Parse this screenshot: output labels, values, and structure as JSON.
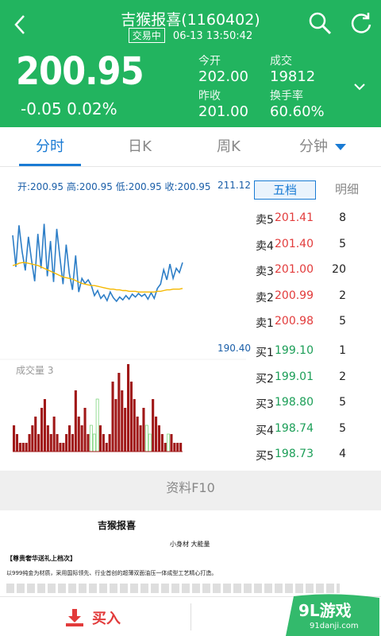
{
  "header": {
    "title": "吉猴报喜(1160402)",
    "status_badge": "交易中",
    "timestamp": "06-13 13:50:42",
    "price": "200.95",
    "change": "-0.05 0.02%",
    "stats": [
      {
        "label": "今开",
        "value": "202.00"
      },
      {
        "label": "成交",
        "value": "19812"
      },
      {
        "label": "昨收",
        "value": "201.00"
      },
      {
        "label": "换手率",
        "value": "60.60%"
      }
    ]
  },
  "tabs": [
    {
      "label": "分时",
      "active": true
    },
    {
      "label": "日K",
      "active": false
    },
    {
      "label": "周K",
      "active": false
    },
    {
      "label": "分钟",
      "active": false
    }
  ],
  "chart": {
    "stats_line": "开:200.95 高:200.95 低:200.95 收:200.95",
    "y_max": "211.12",
    "y_min": "190.40",
    "volume_label": "成交量 3"
  },
  "chart_data": {
    "type": "line",
    "series": [
      {
        "values": [
          205.8,
          201.4,
          207.2,
          203.5,
          200.9,
          205.6,
          202.3,
          199.4,
          206.0,
          201.2,
          207.4,
          200.1,
          205.0,
          199.3,
          206.7,
          202.8,
          199.0,
          204.5,
          200.5,
          198.2,
          203.0,
          197.9,
          199.8,
          199.1,
          199.6,
          198.8,
          197.4,
          198.1,
          197.0,
          197.5,
          196.7,
          197.9,
          197.1,
          196.6,
          197.2,
          196.8,
          197.4,
          196.9,
          197.6,
          197.2,
          197.7,
          197.3,
          197.6,
          196.9,
          197.8,
          197.0,
          198.4,
          199.0,
          201.0,
          199.6,
          201.8,
          199.8,
          201.2,
          200.6,
          202.0
        ]
      },
      {
        "values": [
          201.6,
          201.7,
          201.9,
          202.0,
          202.0,
          201.9,
          201.8,
          201.7,
          201.6,
          201.4,
          201.2,
          201.0,
          200.8,
          200.6,
          200.4,
          200.2,
          200.0,
          199.9,
          199.8,
          199.7,
          199.5,
          199.3,
          199.1,
          199.0,
          198.9,
          198.8,
          198.8,
          198.7,
          198.6,
          198.5,
          198.4,
          198.3,
          198.3,
          198.2,
          198.2,
          198.1,
          198.1,
          198.0,
          198.0,
          198.0,
          197.9,
          197.9,
          197.9,
          197.9,
          197.9,
          197.9,
          198.0,
          198.0,
          198.1,
          198.2,
          198.2,
          198.3,
          198.3,
          198.3,
          198.4
        ]
      }
    ],
    "volumes": [
      3,
      2,
      1,
      1,
      1,
      2,
      3,
      4,
      2,
      5,
      6,
      3,
      2,
      4,
      2,
      1,
      1,
      2,
      3,
      2,
      7,
      4,
      3,
      5,
      2,
      3,
      2,
      6,
      3,
      2,
      1,
      2,
      8,
      6,
      9,
      7,
      5,
      10,
      8,
      6,
      4,
      3,
      5,
      3,
      2,
      6,
      4,
      3,
      2,
      1,
      2,
      2,
      1,
      1,
      1
    ],
    "volume_up": [
      false,
      false,
      false,
      false,
      false,
      false,
      false,
      false,
      false,
      false,
      false,
      false,
      false,
      false,
      false,
      false,
      false,
      false,
      false,
      false,
      false,
      false,
      false,
      false,
      false,
      true,
      true,
      true,
      false,
      false,
      false,
      false,
      false,
      false,
      false,
      false,
      false,
      false,
      false,
      false,
      false,
      false,
      false,
      true,
      true,
      false,
      false,
      false,
      false,
      false,
      true,
      false,
      false,
      false,
      false
    ],
    "ylim": [
      190.4,
      211.12
    ]
  },
  "orderbook": {
    "tab_selected": "五档",
    "tab_other": "明细",
    "asks": [
      {
        "label": "卖5",
        "price": "201.41",
        "volume": "8"
      },
      {
        "label": "卖4",
        "price": "201.40",
        "volume": "5"
      },
      {
        "label": "卖3",
        "price": "201.00",
        "volume": "20"
      },
      {
        "label": "卖2",
        "price": "200.99",
        "volume": "2"
      },
      {
        "label": "卖1",
        "price": "200.98",
        "volume": "5"
      }
    ],
    "bids": [
      {
        "label": "买1",
        "price": "199.10",
        "volume": "1"
      },
      {
        "label": "买2",
        "price": "199.01",
        "volume": "2"
      },
      {
        "label": "买3",
        "price": "198.80",
        "volume": "5"
      },
      {
        "label": "买4",
        "price": "198.74",
        "volume": "5"
      },
      {
        "label": "买5",
        "price": "198.73",
        "volume": "4"
      }
    ]
  },
  "f10_label": "资料F10",
  "doc": {
    "title": "吉猴报喜",
    "subtitle": "小身材 大能量",
    "bracket": "【尊贵奢华送礼上档次】",
    "line1": "以999纯金为材质，采用国际领先、行业首创的超薄双面油压一体成型工艺精心打造。"
  },
  "bottom": {
    "buy_label": "买入"
  },
  "watermark": {
    "logo": "9L游戏",
    "url": "91danji.com"
  },
  "colors": {
    "brand_green": "#22b45f",
    "accent_blue": "#1a7bd4",
    "ask_red": "#e23b3b",
    "bid_green": "#1b9e57"
  }
}
